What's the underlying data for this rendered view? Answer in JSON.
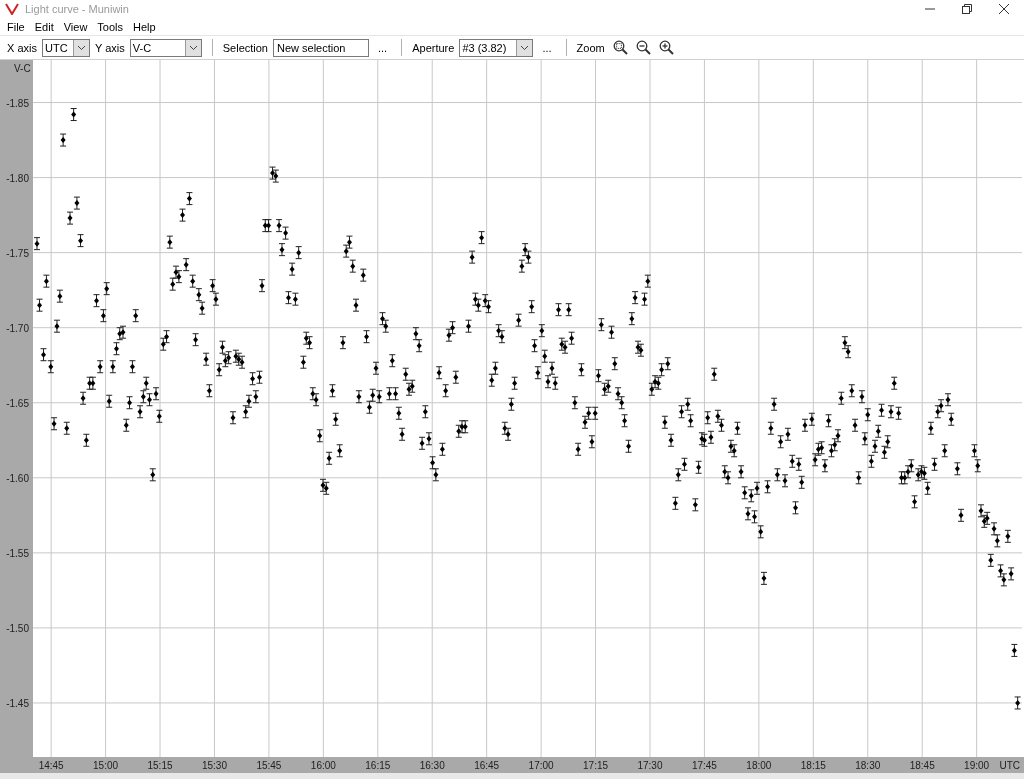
{
  "window": {
    "title": "Light curve - Muniwin"
  },
  "menu": [
    "File",
    "Edit",
    "View",
    "Tools",
    "Help"
  ],
  "toolbar": {
    "x_axis_label": "X axis",
    "x_axis_value": "UTC",
    "y_axis_label": "Y axis",
    "y_axis_value": "V-C",
    "selection_label": "Selection",
    "selection_value": "New selection",
    "selection_more": "...",
    "aperture_label": "Aperture",
    "aperture_value": "#3 (3.82)",
    "aperture_more": "...",
    "zoom_label": "Zoom"
  },
  "chart": {
    "chart_data": {
      "type": "scatter",
      "grid": true,
      "xlabel": "UTC",
      "ylabel": "V-C",
      "xlim": [
        880,
        1152.5
      ],
      "ylim": [
        -1.414,
        -1.877
      ],
      "xticks": [
        {
          "value": 885,
          "label": "14:45"
        },
        {
          "value": 900,
          "label": "15:00"
        },
        {
          "value": 915,
          "label": "15:15"
        },
        {
          "value": 930,
          "label": "15:30"
        },
        {
          "value": 945,
          "label": "15:45"
        },
        {
          "value": 960,
          "label": "16:00"
        },
        {
          "value": 975,
          "label": "16:15"
        },
        {
          "value": 990,
          "label": "16:30"
        },
        {
          "value": 1005,
          "label": "16:45"
        },
        {
          "value": 1020,
          "label": "17:00"
        },
        {
          "value": 1035,
          "label": "17:15"
        },
        {
          "value": 1050,
          "label": "17:30"
        },
        {
          "value": 1065,
          "label": "17:45"
        },
        {
          "value": 1080,
          "label": "18:00"
        },
        {
          "value": 1095,
          "label": "18:15"
        },
        {
          "value": 1110,
          "label": "18:30"
        },
        {
          "value": 1125,
          "label": "18:45"
        },
        {
          "value": 1140,
          "label": "19:00"
        }
      ],
      "yticks": [
        {
          "value": -1.85,
          "label": "-1.85"
        },
        {
          "value": -1.8,
          "label": "-1.80"
        },
        {
          "value": -1.75,
          "label": "-1.75"
        },
        {
          "value": -1.7,
          "label": "-1.70"
        },
        {
          "value": -1.65,
          "label": "-1.65"
        },
        {
          "value": -1.6,
          "label": "-1.60"
        },
        {
          "value": -1.55,
          "label": "-1.55"
        },
        {
          "value": -1.5,
          "label": "-1.50"
        },
        {
          "value": -1.45,
          "label": "-1.45"
        }
      ],
      "x": [
        881.1,
        881.8,
        882.9,
        883.7,
        884.9,
        885.8,
        886.6,
        887.4,
        888.3,
        889.3,
        890.2,
        891.2,
        892.1,
        893.1,
        893.8,
        894.7,
        895.6,
        896.5,
        897.5,
        898.5,
        899.4,
        900.3,
        901.0,
        902.0,
        903.0,
        903.9,
        904.8,
        905.7,
        906.6,
        907.4,
        908.3,
        909.5,
        910.4,
        911.2,
        912.1,
        913.0,
        913.9,
        914.8,
        915.9,
        916.8,
        917.7,
        918.5,
        919.4,
        920.2,
        921.2,
        922.2,
        923.1,
        924.0,
        924.8,
        925.7,
        926.6,
        927.7,
        928.6,
        929.5,
        930.4,
        931.3,
        932.2,
        933.0,
        933.9,
        935.1,
        935.9,
        936.7,
        937.6,
        938.6,
        939.5,
        940.5,
        941.4,
        942.4,
        943.1,
        944.0,
        944.9,
        946.0,
        946.9,
        947.8,
        948.6,
        949.6,
        950.4,
        951.4,
        952.3,
        953.2,
        954.5,
        955.3,
        956.2,
        957.1,
        958.0,
        959.0,
        959.9,
        960.8,
        961.6,
        962.5,
        963.4,
        964.5,
        965.4,
        966.3,
        967.2,
        968.1,
        969.0,
        969.8,
        971.0,
        971.9,
        972.7,
        973.6,
        974.5,
        975.4,
        976.3,
        977.2,
        978.2,
        979.0,
        979.9,
        980.8,
        981.7,
        982.7,
        983.6,
        984.5,
        985.5,
        986.4,
        987.2,
        988.1,
        989.1,
        990.1,
        991.0,
        991.9,
        992.8,
        993.7,
        994.6,
        995.6,
        996.5,
        997.3,
        998.2,
        999.1,
        1000.0,
        1001.0,
        1001.9,
        1002.7,
        1003.6,
        1004.6,
        1005.5,
        1006.4,
        1007.4,
        1008.3,
        1009.2,
        1010.0,
        1010.9,
        1011.8,
        1012.7,
        1013.8,
        1014.7,
        1015.6,
        1016.5,
        1017.4,
        1018.2,
        1019.1,
        1020.2,
        1021.0,
        1021.9,
        1023.0,
        1023.9,
        1024.8,
        1025.7,
        1026.6,
        1027.6,
        1028.4,
        1029.3,
        1030.2,
        1031.1,
        1032.1,
        1033.1,
        1034.0,
        1034.9,
        1035.8,
        1036.6,
        1037.5,
        1038.5,
        1039.4,
        1040.3,
        1041.2,
        1042.2,
        1043.0,
        1044.1,
        1045.0,
        1045.9,
        1046.7,
        1047.5,
        1048.5,
        1049.4,
        1050.5,
        1051.4,
        1052.3,
        1053.2,
        1054.1,
        1054.9,
        1055.8,
        1057.0,
        1057.8,
        1058.7,
        1059.5,
        1060.4,
        1061.2,
        1062.5,
        1063.4,
        1064.3,
        1065.0,
        1065.9,
        1066.8,
        1067.7,
        1068.7,
        1069.7,
        1070.6,
        1071.5,
        1072.3,
        1073.2,
        1074.1,
        1075.1,
        1076.1,
        1077.0,
        1077.9,
        1078.8,
        1079.5,
        1080.5,
        1081.4,
        1082.4,
        1083.3,
        1084.2,
        1085.1,
        1086.0,
        1087.2,
        1088.0,
        1089.2,
        1090.1,
        1091.0,
        1091.8,
        1092.7,
        1094.6,
        1095.5,
        1096.4,
        1097.3,
        1098.2,
        1099.2,
        1100.0,
        1100.9,
        1101.8,
        1102.7,
        1103.7,
        1104.6,
        1105.6,
        1106.5,
        1107.5,
        1108.4,
        1109.2,
        1110.0,
        1111.0,
        1112.0,
        1112.9,
        1113.8,
        1114.6,
        1115.5,
        1116.4,
        1117.3,
        1118.5,
        1119.3,
        1120.2,
        1121.1,
        1122.0,
        1122.9,
        1123.9,
        1124.8,
        1125.6,
        1126.5,
        1127.4,
        1128.4,
        1129.3,
        1130.2,
        1131.2,
        1132.1,
        1133.0,
        1134.7,
        1135.7,
        1139.4,
        1140.3,
        1141.2,
        1142.1,
        1142.9,
        1143.9,
        1144.8,
        1145.7,
        1146.6,
        1147.5,
        1148.6,
        1149.5,
        1150.4,
        1151.3
      ],
      "series": [
        {
          "values": [
            -1.756,
            -1.715,
            -1.682,
            -1.731,
            -1.674,
            -1.636,
            -1.701,
            -1.721,
            -1.825,
            -1.633,
            -1.773,
            -1.842,
            -1.783,
            -1.758,
            -1.653,
            -1.625,
            -1.663,
            -1.663,
            -1.718,
            -1.674,
            -1.708,
            -1.726,
            -1.651,
            -1.674,
            -1.686,
            -1.696,
            -1.697,
            -1.635,
            -1.65,
            -1.674,
            -1.708,
            -1.644,
            -1.654,
            -1.663,
            -1.652,
            -1.602,
            -1.656,
            -1.641,
            -1.689,
            -1.694,
            -1.757,
            -1.729,
            -1.737,
            -1.734,
            -1.775,
            -1.742,
            -1.786,
            -1.731,
            -1.692,
            -1.722,
            -1.713,
            -1.679,
            -1.658,
            -1.728,
            -1.719,
            -1.672,
            -1.687,
            -1.678,
            -1.68,
            -1.64,
            -1.681,
            -1.679,
            -1.677,
            -1.644,
            -1.651,
            -1.666,
            -1.654,
            -1.667,
            -1.728,
            -1.768,
            -1.768,
            -1.803,
            -1.801,
            -1.768,
            -1.752,
            -1.763,
            -1.72,
            -1.739,
            -1.719,
            -1.75,
            -1.677,
            -1.693,
            -1.69,
            -1.656,
            -1.652,
            -1.628,
            -1.595,
            -1.593,
            -1.613,
            -1.658,
            -1.639,
            -1.618,
            -1.69,
            -1.751,
            -1.757,
            -1.741,
            -1.715,
            -1.654,
            -1.735,
            -1.694,
            -1.647,
            -1.655,
            -1.673,
            -1.654,
            -1.706,
            -1.701,
            -1.656,
            -1.678,
            -1.656,
            -1.643,
            -1.629,
            -1.669,
            -1.659,
            -1.661,
            -1.696,
            -1.688,
            -1.623,
            -1.644,
            -1.626,
            -1.61,
            -1.602,
            -1.67,
            -1.619,
            -1.658,
            -1.695,
            -1.7,
            -1.667,
            -1.631,
            -1.634,
            -1.634,
            -1.701,
            -1.747,
            -1.719,
            -1.715,
            -1.76,
            -1.718,
            -1.714,
            -1.665,
            -1.673,
            -1.698,
            -1.694,
            -1.633,
            -1.629,
            -1.649,
            -1.663,
            -1.705,
            -1.741,
            -1.752,
            -1.747,
            -1.714,
            -1.688,
            -1.67,
            -1.698,
            -1.681,
            -1.664,
            -1.673,
            -1.663,
            -1.712,
            -1.689,
            -1.687,
            -1.712,
            -1.693,
            -1.65,
            -1.619,
            -1.672,
            -1.637,
            -1.643,
            -1.624,
            -1.643,
            -1.668,
            -1.702,
            -1.659,
            -1.661,
            -1.697,
            -1.676,
            -1.656,
            -1.65,
            -1.638,
            -1.621,
            -1.706,
            -1.72,
            -1.687,
            -1.685,
            -1.719,
            -1.731,
            -1.659,
            -1.664,
            -1.663,
            -1.672,
            -1.637,
            -1.676,
            -1.625,
            -1.583,
            -1.602,
            -1.644,
            -1.609,
            -1.649,
            -1.638,
            -1.582,
            -1.607,
            -1.626,
            -1.625,
            -1.64,
            -1.627,
            -1.669,
            -1.641,
            -1.635,
            -1.604,
            -1.6,
            -1.621,
            -1.618,
            -1.633,
            -1.604,
            -1.59,
            -1.576,
            -1.588,
            -1.574,
            -1.593,
            -1.564,
            -1.533,
            -1.594,
            -1.633,
            -1.649,
            -1.602,
            -1.624,
            -1.598,
            -1.629,
            -1.611,
            -1.58,
            -1.609,
            -1.597,
            -1.635,
            -1.639,
            -1.612,
            -1.619,
            -1.62,
            -1.608,
            -1.638,
            -1.618,
            -1.622,
            -1.628,
            -1.653,
            -1.69,
            -1.684,
            -1.658,
            -1.635,
            -1.6,
            -1.654,
            -1.626,
            -1.642,
            -1.611,
            -1.621,
            -1.631,
            -1.645,
            -1.617,
            -1.624,
            -1.644,
            -1.663,
            -1.643,
            -1.6,
            -1.6,
            -1.604,
            -1.608,
            -1.584,
            -1.602,
            -1.604,
            -1.603,
            -1.593,
            -1.633,
            -1.609,
            -1.644,
            -1.648,
            -1.618,
            -1.652,
            -1.639,
            -1.606,
            -1.575,
            -1.618,
            -1.608,
            -1.578,
            -1.571,
            -1.573,
            -1.545,
            -1.566,
            -1.558,
            -1.538,
            -1.532,
            -1.561,
            -1.536,
            -1.485,
            -1.45
          ]
        }
      ]
    }
  }
}
